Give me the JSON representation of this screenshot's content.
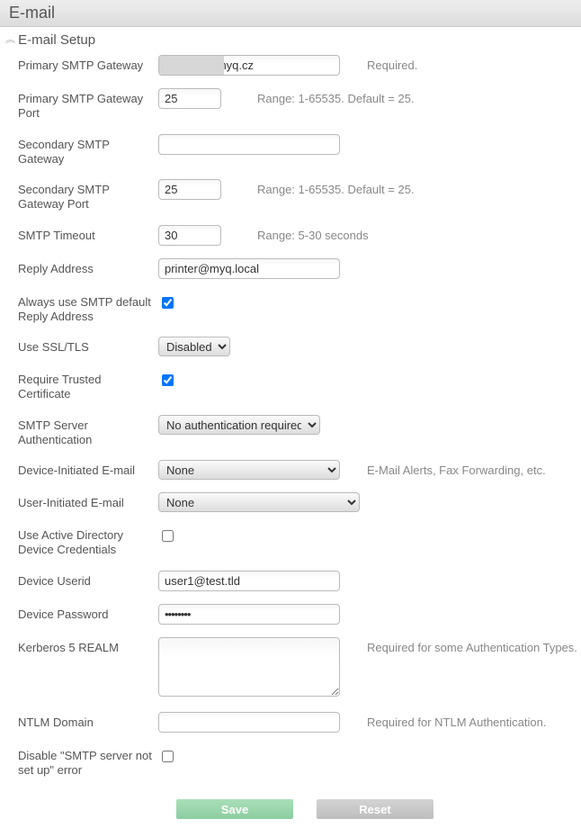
{
  "header": {
    "title": "E-mail"
  },
  "section": {
    "title": "E-mail Setup"
  },
  "smtp": {
    "primary_gateway_label": "Primary SMTP Gateway",
    "primary_gateway_value": "myq.cz",
    "primary_gateway_hint": "Required.",
    "primary_port_label": "Primary SMTP Gateway Port",
    "primary_port_value": "25",
    "primary_port_hint": "Range: 1-65535. Default = 25.",
    "secondary_gateway_label": "Secondary SMTP Gateway",
    "secondary_gateway_value": "",
    "secondary_port_label": "Secondary SMTP Gateway Port",
    "secondary_port_value": "25",
    "secondary_port_hint": "Range: 1-65535. Default = 25.",
    "timeout_label": "SMTP Timeout",
    "timeout_value": "30",
    "timeout_hint": "Range: 5-30 seconds",
    "reply_label": "Reply Address",
    "reply_value": "printer@myq.local",
    "always_reply_label": "Always use SMTP default Reply Address",
    "ssl_label": "Use SSL/TLS",
    "ssl_value": "Disabled",
    "trusted_label": "Require Trusted Certificate",
    "auth_label": "SMTP Server Authentication",
    "auth_value": "No authentication required",
    "dev_email_label": "Device-Initiated E-mail",
    "dev_email_value": "None",
    "dev_email_hint": "E-Mail Alerts, Fax Forwarding, etc.",
    "user_email_label": "User-Initiated E-mail",
    "user_email_value": "None",
    "ad_creds_label": "Use Active Directory Device Credentials",
    "userid_label": "Device Userid",
    "userid_value": "user1@test.tld",
    "password_label": "Device Password",
    "password_value": "••••••••",
    "kerberos_label": "Kerberos 5 REALM",
    "kerberos_value": "",
    "kerberos_hint": "Required for some Authentication Types.",
    "ntlm_label": "NTLM Domain",
    "ntlm_value": "",
    "ntlm_hint": "Required for NTLM Authentication.",
    "disable_err_label": "Disable \"SMTP server not set up\" error"
  },
  "buttons": {
    "save": "Save",
    "reset": "Reset"
  }
}
